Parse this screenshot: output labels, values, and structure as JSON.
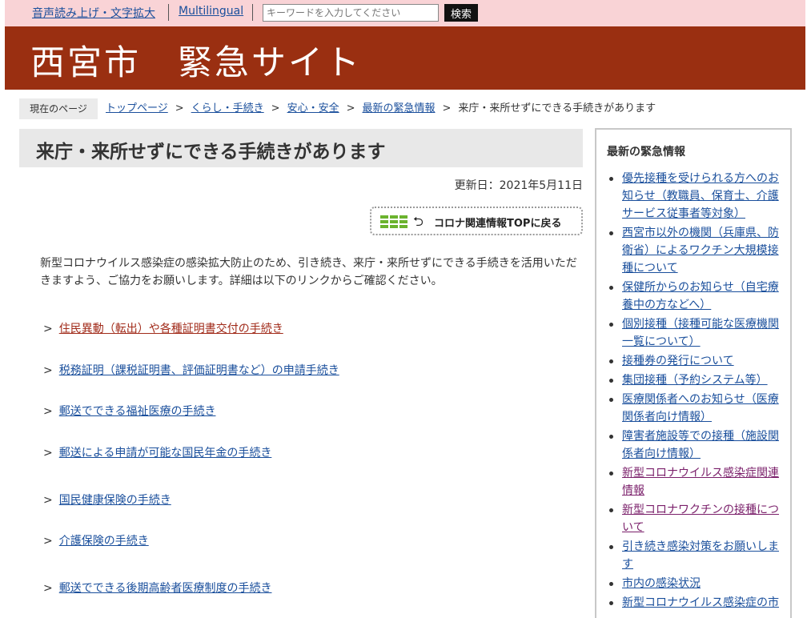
{
  "topbar": {
    "accessibility_link": "音声読み上げ・文字拡大",
    "multilingual_link": "Multilingual",
    "search_placeholder": "キーワードを入力してください",
    "search_button": "検索"
  },
  "header": {
    "site_title": "西宮市　緊急サイト",
    "brand_color": "#9a2f11"
  },
  "breadcrumb": {
    "here_label": "現在のページ",
    "items": [
      "トップページ",
      "くらし・手続き",
      "安心・安全",
      "最新の緊急情報"
    ],
    "current": "来庁・来所せずにできる手続きがあります",
    "separator": ">"
  },
  "main": {
    "page_title": "来庁・来所せずにできる手続きがあります",
    "updated": "更新日：2021年5月11日",
    "back_button": "コロナ関連情報TOPに戻る",
    "intro": "新型コロナウイルス感染症の感染拡大防止のため、引き続き、来庁・来所せずにできる手続きを活用いただきますよう、ご協力をお願いします。詳細は以下のリンクからご確認ください。",
    "link_marker": ">",
    "links": [
      "住民異動（転出）や各種証明書交付の手続き",
      "税務証明（課税証明書、評価証明書など）の申請手続き",
      "郵送でできる福祉医療の手続き",
      "郵送による申請が可能な国民年金の手続き",
      "国民健康保険の手続き",
      "介護保険の手続き",
      "郵送でできる後期高齢者医療制度の手続き"
    ]
  },
  "sidebar": {
    "title": "最新の緊急情報",
    "items": [
      "優先接種を受けられる方へのお知らせ（教職員、保育士、介護サービス従事者等対象）",
      "西宮市以外の機関（兵庫県、防衛省）によるワクチン大規模接種について",
      "保健所からのお知らせ（自宅療養中の方などへ）",
      "個別接種（接種可能な医療機関一覧について）",
      "接種券の発行について",
      "集団接種（予約システム等）",
      "医療関係者へのお知らせ（医療関係者向け情報）",
      "障害者施設等での接種（施設関係者向け情報）",
      "新型コロナウイルス感染症関連情報",
      "新型コロナワクチンの接種について",
      "引き続き感染対策をお願いします",
      "市内の感染状況",
      "新型コロナウイルス感染症の市"
    ]
  },
  "icons": {
    "back_grid": "grid-icon",
    "back_arrow": "return-arrow-icon"
  },
  "colors": {
    "topbar_bg": "#f9d3d6",
    "link": "#1a4f9c",
    "visited_link": "#a12b1a",
    "sidebar_visited": "#7a1f6a",
    "accent_green": "#6bb32e"
  }
}
